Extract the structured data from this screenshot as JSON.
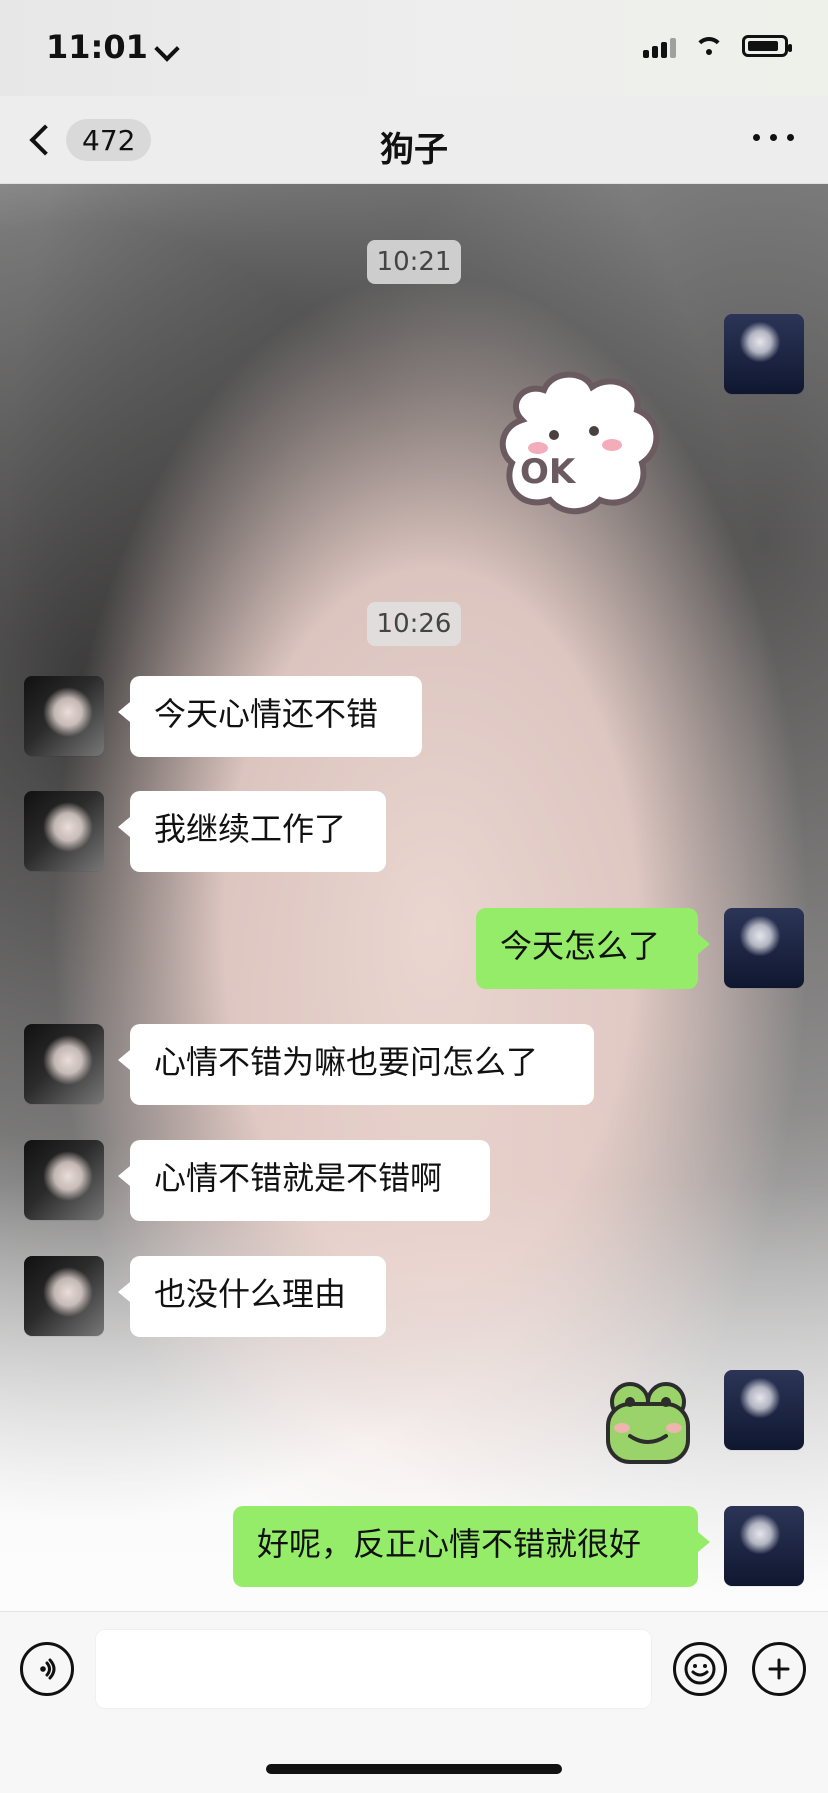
{
  "status_bar": {
    "time": "11:01"
  },
  "nav": {
    "unread_count": "472",
    "title": "狗子"
  },
  "timestamps": [
    "10:21",
    "10:26"
  ],
  "messages": [
    {
      "text": "今天心情还不错"
    },
    {
      "text": "我继续工作了"
    },
    {
      "text": "今天怎么了"
    },
    {
      "text": "心情不错为嘛也要问怎么了"
    },
    {
      "text": "心情不错就是不错啊"
    },
    {
      "text": "也没什么理由"
    },
    {
      "text": "好呢，反正心情不错就很好"
    }
  ],
  "stickers": {
    "ok_text": "OK"
  },
  "input": {
    "value": "",
    "placeholder": ""
  },
  "colors": {
    "bubble_me": "#95ec69",
    "bubble_other": "#ffffff",
    "nav_bg": "#ededed"
  },
  "icons": {
    "back": "back-chevron-icon",
    "more": "more-dots-icon",
    "voice": "voice-icon",
    "emoji": "emoji-icon",
    "plus": "plus-icon"
  }
}
